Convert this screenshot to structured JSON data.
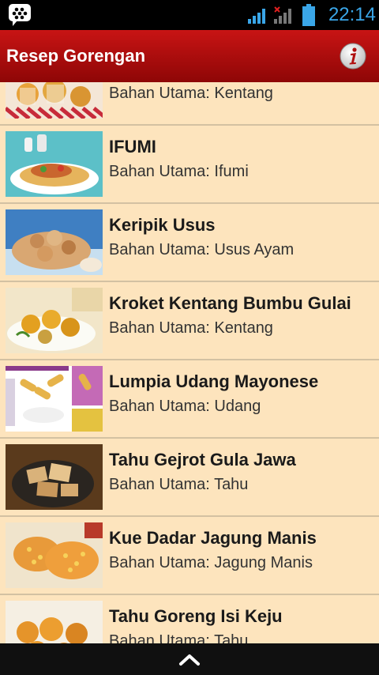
{
  "status": {
    "time": "22:14",
    "colors": {
      "accent": "#3aa6e8"
    },
    "icons": [
      "bbm-icon",
      "signal-icon",
      "no-signal-icon",
      "battery-icon"
    ]
  },
  "header": {
    "title": "Resep Gorengan",
    "info_icon": "info-icon",
    "colors": {
      "bar_top": "#c81414",
      "bar_bottom": "#8e0606"
    }
  },
  "list": {
    "label_prefix": "Bahan Utama:",
    "items": [
      {
        "title": "",
        "ingredient": "Kentang"
      },
      {
        "title": "IFUMI",
        "ingredient": "Ifumi"
      },
      {
        "title": "Keripik Usus",
        "ingredient": "Usus Ayam"
      },
      {
        "title": "Kroket Kentang Bumbu Gulai",
        "ingredient": "Kentang"
      },
      {
        "title": "Lumpia Udang Mayonese",
        "ingredient": "Udang"
      },
      {
        "title": "Tahu Gejrot Gula Jawa",
        "ingredient": "Tahu"
      },
      {
        "title": "Kue Dadar Jagung Manis",
        "ingredient": "Jagung Manis"
      },
      {
        "title": "Tahu Goreng Isi Keju",
        "ingredient": "Tahu"
      }
    ],
    "colors": {
      "row_bg": "#fde4bd",
      "divider": "#d3c1a2"
    }
  },
  "footer": {
    "scroll_up_icon": "chevron-up-icon"
  }
}
